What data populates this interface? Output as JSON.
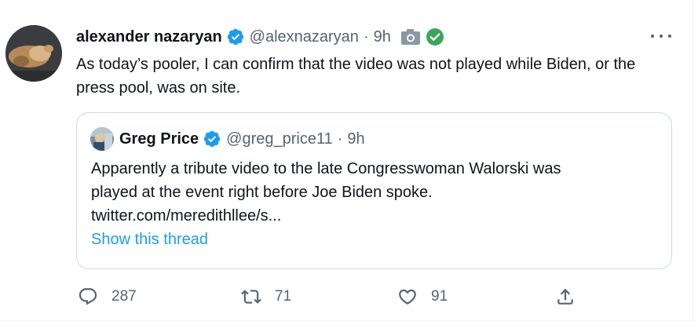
{
  "tweet": {
    "author_name": "alexander nazaryan",
    "author_handle": "@alexnazaryan",
    "separator": "·",
    "time": "9h",
    "text": "As today’s pooler, I can confirm that the video was not played while Biden, or the press pool, was on site."
  },
  "quote": {
    "author_name": "Greg Price",
    "author_handle": "@greg_price11",
    "separator": "·",
    "time": "9h",
    "text_line1": "Apparently a tribute video to the late Congresswoman Walorski was",
    "text_line2": "played at the event right before Joe Biden spoke.",
    "text_line3": "twitter.com/meredithllee/s...",
    "show_thread": "Show this thread"
  },
  "actions": {
    "replies": "287",
    "retweets": "71",
    "likes": "91"
  },
  "colors": {
    "verified_blue": "#1d9bf0",
    "check_green": "#3ba55c",
    "muted": "#536471",
    "border": "#cfd9de"
  },
  "icons": [
    "verified-badge-icon",
    "camera-icon",
    "green-check-icon",
    "more-icon",
    "reply-icon",
    "retweet-icon",
    "like-icon",
    "share-icon"
  ]
}
